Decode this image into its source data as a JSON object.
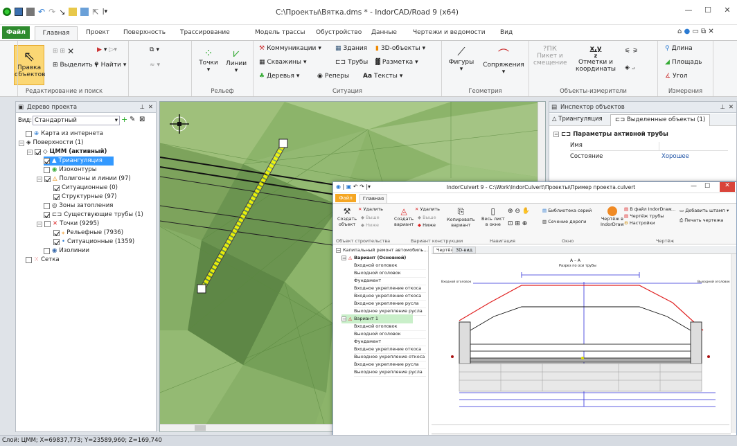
{
  "app": {
    "title": "C:\\Проекты\\Вятка.dms * - IndorCAD/Road 9 (x64)"
  },
  "tabs": {
    "file": "Файл",
    "items": [
      "Главная",
      "Проект",
      "Поверхность",
      "Трассирование",
      "Модель трассы",
      "Обустройство",
      "Данные",
      "Чертежи и ведомости",
      "Вид"
    ]
  },
  "ribbon": {
    "edit_group": "Редактирование и поиск",
    "edit_objects": "Правка",
    "edit_objects2": "объектов",
    "select": "Выделить",
    "find": "Найти",
    "relief_group": "Рельеф",
    "points": "Точки",
    "lines": "Линии",
    "situation_group": "Ситуация",
    "communications": "Коммуникации",
    "buildings": "Здания",
    "objects3d": "3D-объекты",
    "wells": "Скважины",
    "pipes": "Трубы",
    "marking": "Разметка",
    "trees": "Деревья",
    "benchmarks": "Реперы",
    "texts": "Тексты",
    "aa": "Aa",
    "geometry_group": "Геометрия",
    "figures": "Фигуры",
    "joints": "Сопряжения",
    "measure_group": "Объекты-измерители",
    "picket": "Пикет и",
    "offset": "смещение",
    "marks": "Отметки и",
    "coords": "координаты",
    "xy": "x,y",
    "z": "z",
    "pk": "ПК",
    "measurements_group": "Измерения",
    "length": "Длина",
    "area": "Площадь",
    "angle": "Угол"
  },
  "tree": {
    "title": "Дерево проекта",
    "view_label": "Вид:",
    "view_value": "Стандартный",
    "items": [
      "Карта из интернета",
      "Поверхности (1)",
      "ЦММ (активный)",
      "Триангуляция",
      "Изоконтуры",
      "Полигоны и линии (97)",
      "Ситуационные (0)",
      "Структурные (97)",
      "Зоны затопления",
      "Существующие трубы (1)",
      "Точки (9295)",
      "Рельефные (7936)",
      "Ситуационные (1359)",
      "Изолинии",
      "Сетка"
    ]
  },
  "inspector": {
    "title": "Инспектор объектов",
    "tab1": "Триангуляция",
    "tab2": "Выделенные объекты (1)",
    "section": "Параметры активной трубы",
    "name_label": "Имя",
    "state_label": "Состояние",
    "state_value": "Хорошее"
  },
  "culvert": {
    "title": "IndorCulvert 9 - C:\\Work\\IndorCulvert\\Проекты\\Пример проекта.culvert",
    "file": "Файл",
    "home": "Главная",
    "delete": "Удалить",
    "up": "Выше",
    "down": "Ниже",
    "create_object": "Создать",
    "create_object2": "объект",
    "create_variant": "Создать",
    "create_variant2": "вариант",
    "copy_variant": "Копировать",
    "copy_variant2": "вариант",
    "whole_sheet": "Весь лист",
    "whole_sheet2": "в окне",
    "series_lib": "Библиотека серий",
    "road_section": "Сечение дороги",
    "drawing_indor": "Чертёж в",
    "drawing_indor2": "IndorDraw",
    "to_file": "В файл IndorDraw...",
    "pipe_drawing": "Чертёж трубы",
    "settings": "Настройки",
    "add_frame": "Добавить штамп",
    "print_drawing": "Печать чертежа",
    "g_object": "Объект строительства",
    "g_variant": "Вариант конструкции",
    "g_nav": "Навигация",
    "g_window": "Окно",
    "g_drawing": "Чертёж",
    "root": "Капитальный ремонт автомобиль...",
    "variant_main": "Вариант (Основной)",
    "variant1": "Вариант 1",
    "v_items": [
      "Входной оголовок",
      "Выходной оголовок",
      "Фундамент",
      "Входное укрепление откоса",
      "Входное укрепление откоса",
      "Входное укрепление русла",
      "Выходное укрепление русла"
    ],
    "v1_items": [
      "Входной оголовок",
      "Выходной оголовок",
      "Фундамент",
      "Входное укрепление откоса",
      "Выходное укрепление откоса",
      "Входное укрепление русла",
      "Выходное укрепление русла"
    ],
    "tab_drawing": "Чертёж",
    "tab_3d": "3D-вид",
    "section_title": "А – А",
    "section_sub": "Разрез по оси трубы",
    "left_note": "Входной оголовок",
    "right_note": "Выходной оголовок"
  },
  "status": {
    "text": "Слой: ЦММ; X=69837,773; Y=23589,960; Z=169,740"
  },
  "colors": {
    "accent": "#2e8b2e",
    "selection": "#3399ff",
    "terrain": "#8cb46a"
  }
}
